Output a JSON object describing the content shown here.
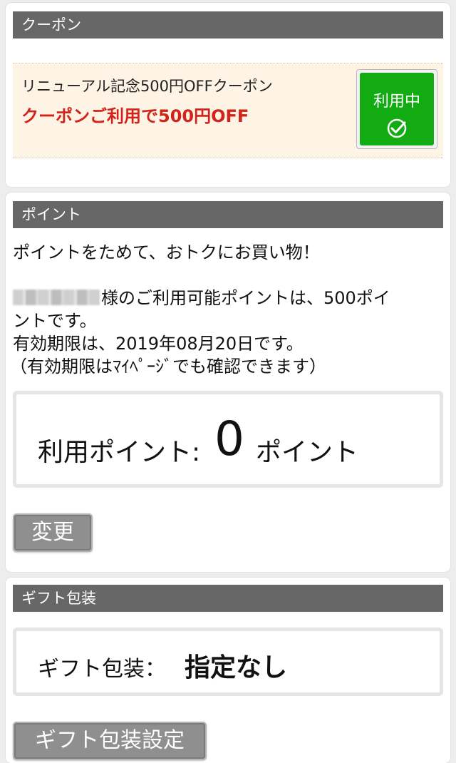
{
  "coupon": {
    "header": "クーポン",
    "name": "リニューアル記念500円OFFクーポン",
    "offer": "クーポンご利用で500円OFF",
    "status_button": "利用中",
    "status_icon": "check-circle-icon",
    "status_color": "#12ac12"
  },
  "points": {
    "header": "ポイント",
    "tagline": "ポイントをためて、おトクにお買い物！",
    "available_line1": "様のご利用可能ポイントは、500ポイ",
    "available_line2": "ントです。",
    "expiry": "有効期限は、2019年08月20日です。",
    "expiry_note": "（有効期限はﾏｲﾍﾟｰｼﾞでも確認できます）",
    "use_label": "利用ポイント:",
    "use_value": "0",
    "use_unit": "ポイント",
    "change_button": "変更"
  },
  "gift": {
    "header": "ギフト包装",
    "label": "ギフト包装：",
    "value": "指定なし",
    "settings_button": "ギフト包装設定"
  }
}
